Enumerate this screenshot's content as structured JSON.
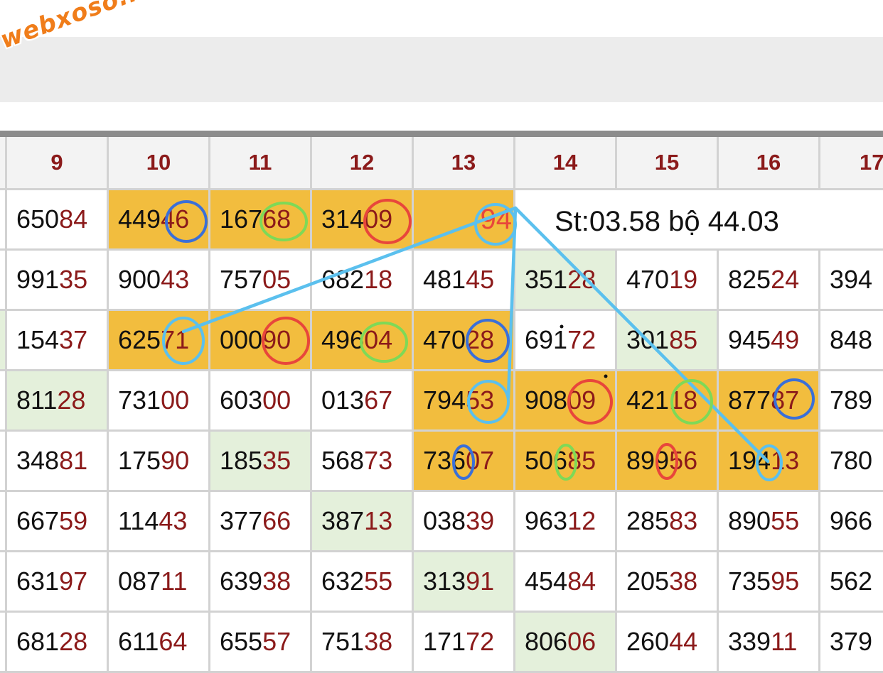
{
  "logo": "webxoso.net",
  "note": "St:03.58 bộ 44.03",
  "colors": {
    "highlight": "#f2bd3e",
    "soft": "#e4f0db",
    "tail": "#8b1a1a",
    "line": "#5bc0ee",
    "blue": "#3a6fd8",
    "green": "#7ed957",
    "red": "#e8463b"
  },
  "columns": [
    "9",
    "10",
    "11",
    "12",
    "13",
    "14",
    "15",
    "16",
    "17"
  ],
  "rows": [
    [
      {
        "head": "650",
        "tail": "84"
      },
      {
        "head": "449",
        "tail": "46",
        "hl": "y"
      },
      {
        "head": "167",
        "tail": "68",
        "hl": "y"
      },
      {
        "head": "314",
        "tail": "09",
        "hl": "y"
      },
      {
        "head": "",
        "tail": "94",
        "hl": "y"
      },
      null,
      null,
      null,
      null
    ],
    [
      {
        "head": "991",
        "tail": "35"
      },
      {
        "head": "900",
        "tail": "43"
      },
      {
        "head": "757",
        "tail": "05"
      },
      {
        "head": "682",
        "tail": "18"
      },
      {
        "head": "481",
        "tail": "45"
      },
      {
        "head": "351",
        "tail": "28",
        "hl": "g"
      },
      {
        "head": "470",
        "tail": "19"
      },
      {
        "head": "825",
        "tail": "24"
      },
      {
        "head": "394",
        "tail": ""
      }
    ],
    [
      {
        "head": "154",
        "tail": "37"
      },
      {
        "head": "625",
        "tail": "71",
        "hl": "y"
      },
      {
        "head": "000",
        "tail": "90",
        "hl": "y"
      },
      {
        "head": "496",
        "tail": "04",
        "hl": "y"
      },
      {
        "head": "470",
        "tail": "28",
        "hl": "y"
      },
      {
        "head": "691",
        "tail": "72"
      },
      {
        "head": "301",
        "tail": "85",
        "hl": "g"
      },
      {
        "head": "945",
        "tail": "49"
      },
      {
        "head": "848",
        "tail": ""
      }
    ],
    [
      {
        "head": "811",
        "tail": "28",
        "hl": "g"
      },
      {
        "head": "731",
        "tail": "00"
      },
      {
        "head": "603",
        "tail": "00"
      },
      {
        "head": "013",
        "tail": "67"
      },
      {
        "head": "794",
        "tail": "53",
        "hl": "y"
      },
      {
        "head": "908",
        "tail": "09",
        "hl": "y"
      },
      {
        "head": "421",
        "tail": "18",
        "hl": "y"
      },
      {
        "head": "877",
        "tail": "87",
        "hl": "y"
      },
      {
        "head": "789",
        "tail": ""
      }
    ],
    [
      {
        "head": "348",
        "tail": "81"
      },
      {
        "head": "175",
        "tail": "90"
      },
      {
        "head": "185",
        "tail": "35",
        "hl": "g"
      },
      {
        "head": "568",
        "tail": "73"
      },
      {
        "head": "736",
        "tail": "07",
        "hl": "y"
      },
      {
        "head": "506",
        "tail": "85",
        "hl": "y"
      },
      {
        "head": "899",
        "tail": "56",
        "hl": "y"
      },
      {
        "head": "194",
        "tail": "13",
        "hl": "y"
      },
      {
        "head": "780",
        "tail": ""
      }
    ],
    [
      {
        "head": "667",
        "tail": "59"
      },
      {
        "head": "114",
        "tail": "43"
      },
      {
        "head": "377",
        "tail": "66"
      },
      {
        "head": "387",
        "tail": "13",
        "hl": "g"
      },
      {
        "head": "038",
        "tail": "39"
      },
      {
        "head": "963",
        "tail": "12"
      },
      {
        "head": "285",
        "tail": "83"
      },
      {
        "head": "890",
        "tail": "55"
      },
      {
        "head": "966",
        "tail": ""
      }
    ],
    [
      {
        "head": "631",
        "tail": "97"
      },
      {
        "head": "087",
        "tail": "11"
      },
      {
        "head": "639",
        "tail": "38"
      },
      {
        "head": "632",
        "tail": "55"
      },
      {
        "head": "313",
        "tail": "91",
        "hl": "g"
      },
      {
        "head": "454",
        "tail": "84"
      },
      {
        "head": "205",
        "tail": "38"
      },
      {
        "head": "735",
        "tail": "95"
      },
      {
        "head": "562",
        "tail": ""
      }
    ],
    [
      {
        "head": "681",
        "tail": "28"
      },
      {
        "head": "611",
        "tail": "64"
      },
      {
        "head": "655",
        "tail": "57"
      },
      {
        "head": "751",
        "tail": "38"
      },
      {
        "head": "171",
        "tail": "72"
      },
      {
        "head": "806",
        "tail": "06",
        "hl": "g"
      },
      {
        "head": "260",
        "tail": "44"
      },
      {
        "head": "339",
        "tail": "11"
      },
      {
        "head": "379",
        "tail": ""
      }
    ]
  ]
}
